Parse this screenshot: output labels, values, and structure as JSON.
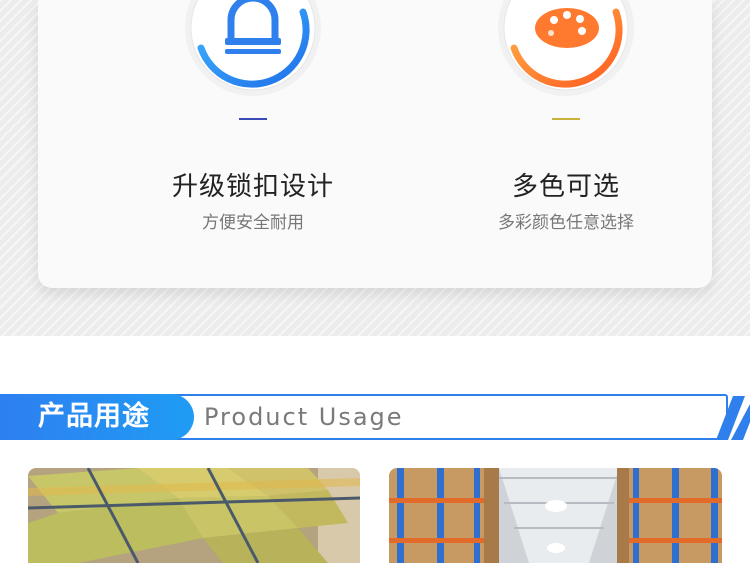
{
  "features": [
    {
      "title": "升级锁扣设计",
      "subtitle": "方便安全耐用",
      "icon": "lock-buckle-icon",
      "accent": "#2f80ed",
      "dash_color": "#3a4bb5"
    },
    {
      "title": "多色可选",
      "subtitle": "多彩颜色任意选择",
      "icon": "color-palette-icon",
      "accent": "#ff7a2e",
      "dash_color": "#c9b23a"
    }
  ],
  "usage_section": {
    "title_cn": "产品用途",
    "title_en": "Product Usage",
    "accent": "#2f80ed"
  },
  "photos": [
    {
      "name": "wrapped-bales-photo"
    },
    {
      "name": "warehouse-shelves-photo"
    }
  ]
}
